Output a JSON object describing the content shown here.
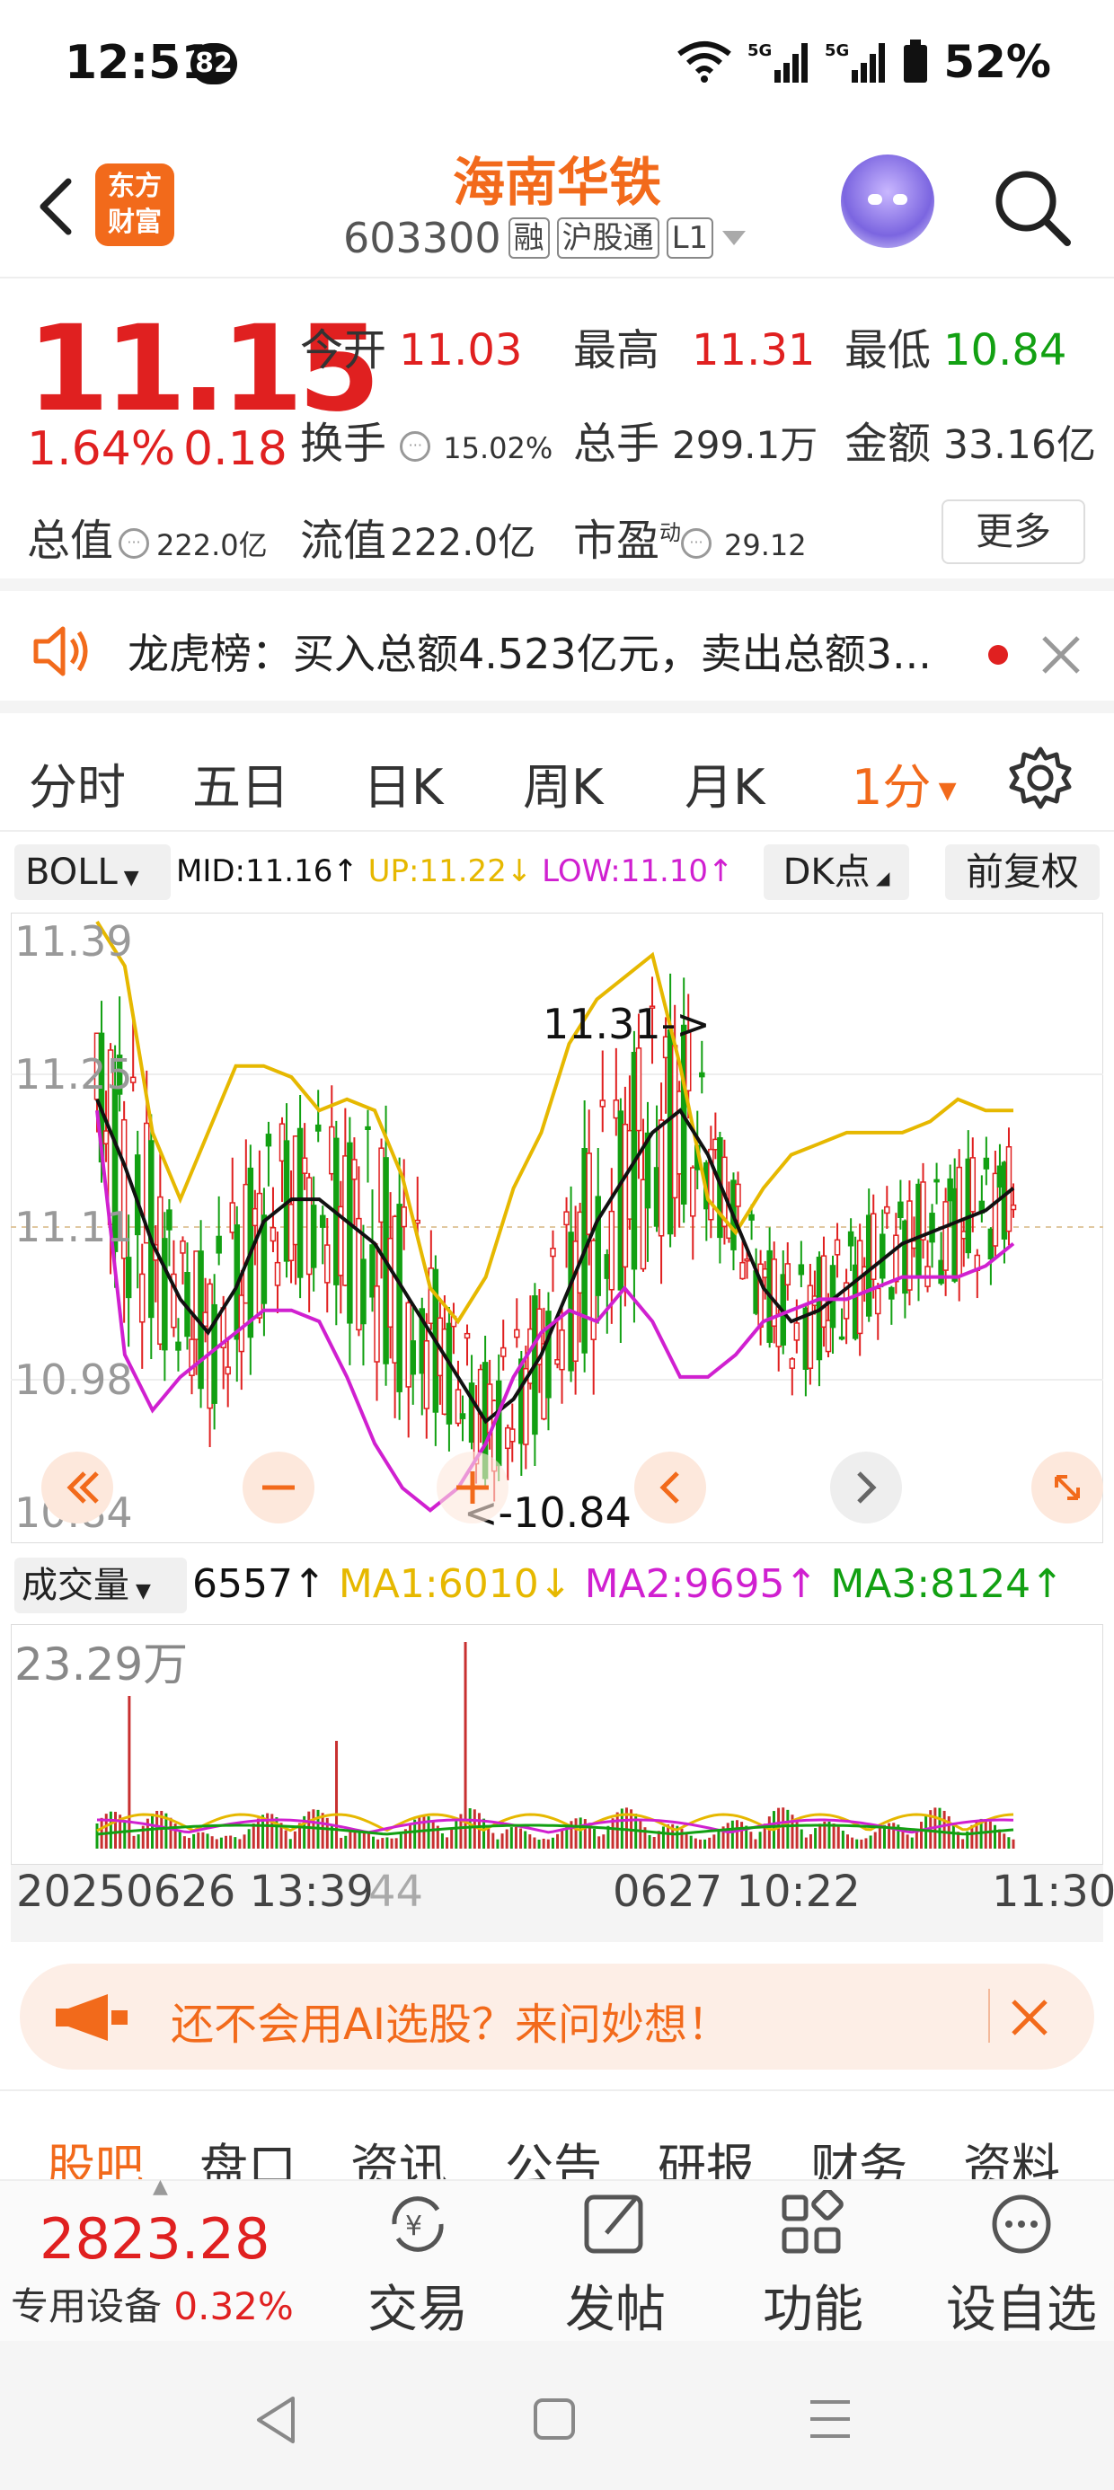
{
  "status": {
    "time": "12:51",
    "badge": "82",
    "signal": "5G",
    "battery": "52%"
  },
  "header": {
    "logo_text": "东方财富",
    "title": "海南华铁",
    "code": "603300",
    "tags": [
      "融",
      "沪股通",
      "L1"
    ]
  },
  "quote": {
    "price": "11.15",
    "change_pct": "1.64%",
    "change": "0.18",
    "open_label": "今开",
    "open": "11.03",
    "high_label": "最高",
    "high": "11.31",
    "low_label": "最低",
    "low": "10.84",
    "turnover_label": "换手",
    "turnover": "15.02%",
    "volume_label": "总手",
    "volume": "299.1万",
    "amount_label": "金额",
    "amount": "33.16亿",
    "mktcap_label": "总值",
    "mktcap": "222.0亿",
    "float_label": "流值",
    "float": "222.0亿",
    "pe_label": "市盈",
    "pe_sup": "动",
    "pe": "29.12",
    "more": "更多"
  },
  "notice": {
    "text": "龙虎榜：买入总额4.523亿元，卖出总额3..."
  },
  "tabs": [
    "分时",
    "五日",
    "日K",
    "周K",
    "月K",
    "1分"
  ],
  "indicator": {
    "name": "BOLL",
    "mid": "MID:11.16↑",
    "up": "UP:11.22↓",
    "low": "LOW:11.10↑",
    "dk": "DK点",
    "fq": "前复权"
  },
  "chart": {
    "y_labels": [
      "11.39",
      "11.25",
      "11.11",
      "10.98",
      "10.84"
    ],
    "high_mark": "11.31->",
    "low_mark": "<-10.84"
  },
  "volume": {
    "name": "成交量",
    "val": "6557↑",
    "ma1": "MA1:6010↓",
    "ma2": "MA2:9695↑",
    "ma3": "MA3:8124↑",
    "max_label": "23.29万"
  },
  "time_axis": {
    "t1": "20250626 13:39",
    "t1b": "44",
    "t2": "0627 10:22",
    "t3": "11:30"
  },
  "ai_banner": {
    "text": "还不会用AI选股？来问妙想！"
  },
  "subtabs": [
    "股吧",
    "盘口",
    "资讯",
    "公告",
    "研报",
    "财务",
    "资料"
  ],
  "bottombar": {
    "index_value": "2823.28",
    "index_name": "专用设备",
    "index_pct": "0.32%",
    "items": [
      "交易",
      "发帖",
      "功能",
      "设自选"
    ]
  },
  "colors": {
    "up": "#e02020",
    "down": "#12a012",
    "accent": "#f26a1b",
    "boll_up": "#e6b800",
    "boll_low": "#d020d0",
    "boll_mid": "#111111"
  },
  "chart_data": {
    "type": "candlestick",
    "ylim": [
      10.84,
      11.39
    ],
    "boll_mid": [
      11.23,
      11.17,
      11.1,
      11.05,
      11.02,
      11.06,
      11.12,
      11.14,
      11.14,
      11.12,
      11.1,
      11.06,
      11.02,
      10.98,
      10.94,
      10.96,
      11.0,
      11.06,
      11.12,
      11.16,
      11.2,
      11.22,
      11.18,
      11.12,
      11.06,
      11.03,
      11.04,
      11.06,
      11.08,
      11.1,
      11.11,
      11.12,
      11.13,
      11.15
    ],
    "boll_up": [
      11.39,
      11.35,
      11.2,
      11.14,
      11.2,
      11.26,
      11.26,
      11.25,
      11.22,
      11.23,
      11.22,
      11.16,
      11.06,
      11.03,
      11.07,
      11.15,
      11.2,
      11.28,
      11.32,
      11.34,
      11.36,
      11.26,
      11.14,
      11.11,
      11.15,
      11.18,
      11.19,
      11.2,
      11.2,
      11.2,
      11.21,
      11.23,
      11.22,
      11.22
    ],
    "boll_low": [
      11.22,
      11.0,
      10.95,
      10.98,
      11.0,
      11.02,
      11.04,
      11.04,
      11.03,
      10.98,
      10.92,
      10.88,
      10.86,
      10.88,
      10.92,
      10.98,
      11.02,
      11.04,
      11.03,
      11.06,
      11.03,
      10.98,
      10.98,
      11.0,
      11.03,
      11.04,
      11.05,
      11.05,
      11.06,
      11.07,
      11.07,
      11.07,
      11.08,
      11.1
    ]
  }
}
